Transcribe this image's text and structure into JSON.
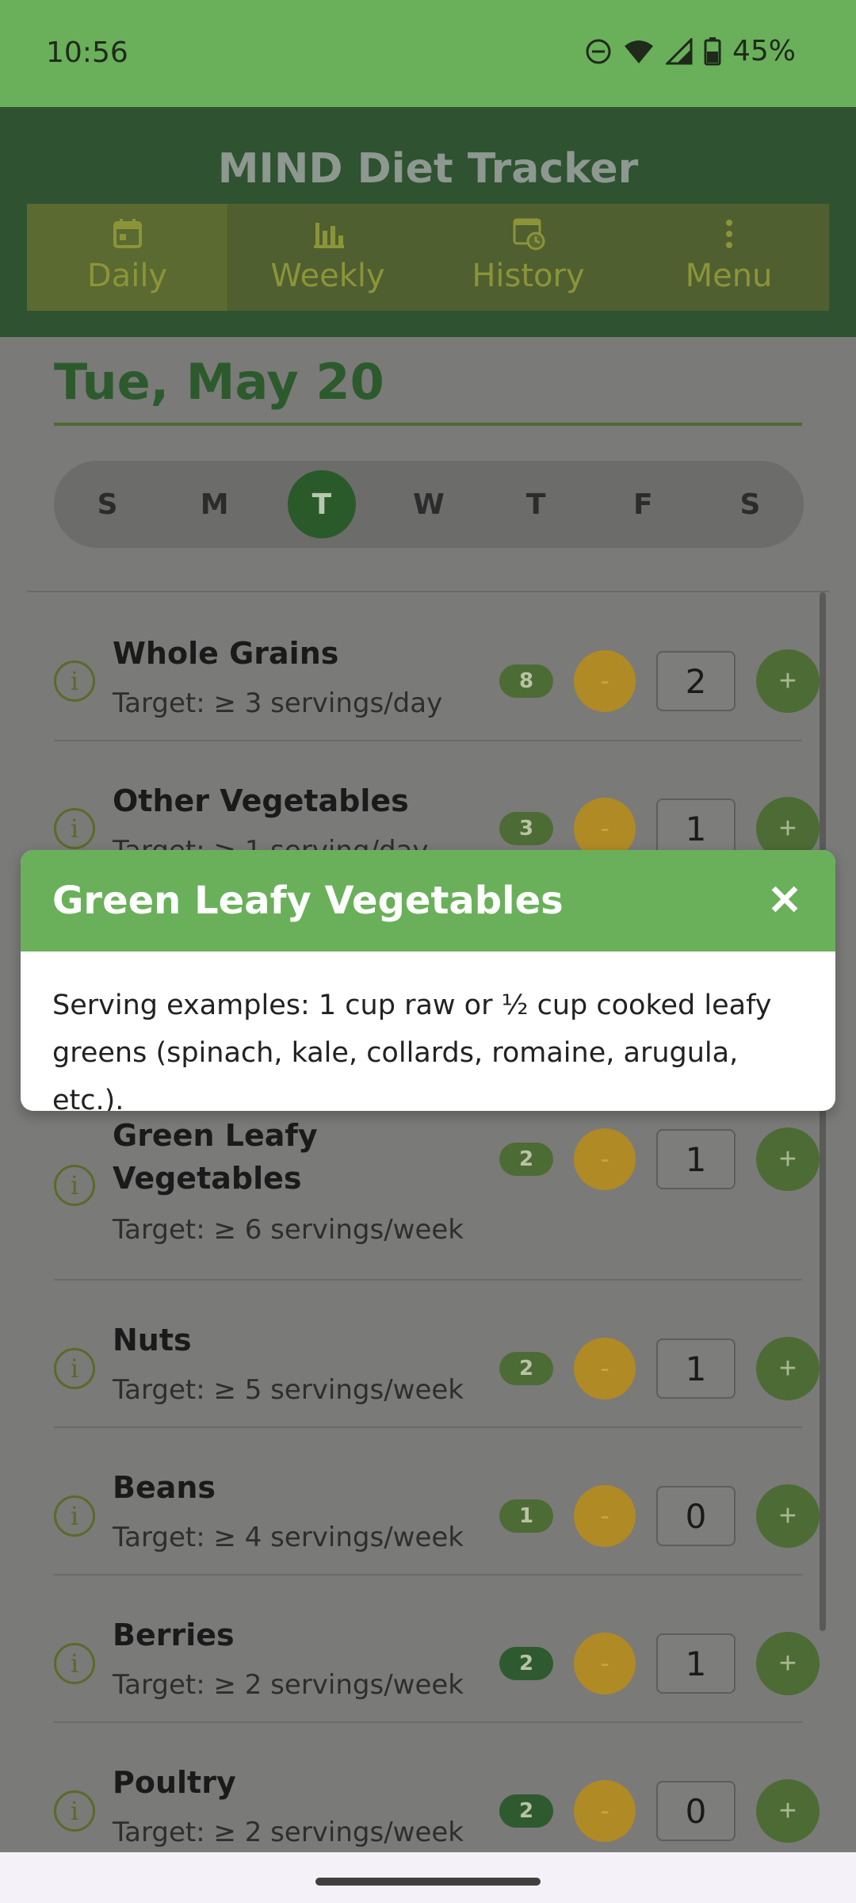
{
  "status_bar": {
    "time": "10:56",
    "battery": "45%"
  },
  "app": {
    "title": "MIND Diet Tracker"
  },
  "tabs": [
    {
      "label": "Daily",
      "icon": "calendar-icon",
      "active": true
    },
    {
      "label": "Weekly",
      "icon": "bar-chart-icon",
      "active": false
    },
    {
      "label": "History",
      "icon": "history-icon",
      "active": false
    },
    {
      "label": "Menu",
      "icon": "more-vertical-icon",
      "active": false
    }
  ],
  "date": {
    "title": "Tue, May 20"
  },
  "week": {
    "days": [
      "S",
      "M",
      "T",
      "W",
      "T",
      "F",
      "S"
    ],
    "active_index": 2
  },
  "foods": [
    {
      "name": "Whole Grains",
      "target": "Target: ≥ 3 servings/day",
      "badge": "8",
      "count": "2"
    },
    {
      "name": "Other Vegetables",
      "target": "Target: ≥ 1 serving/day",
      "badge": "3",
      "count": "1"
    },
    {
      "name": "Green Leafy Vegetables",
      "target": "Target: ≥ 6 servings/week",
      "badge": "2",
      "count": "1"
    },
    {
      "name": "Nuts",
      "target": "Target: ≥ 5 servings/week",
      "badge": "2",
      "count": "1"
    },
    {
      "name": "Beans",
      "target": "Target: ≥ 4 servings/week",
      "badge": "1",
      "count": "0"
    },
    {
      "name": "Berries",
      "target": "Target: ≥ 2 servings/week",
      "badge": "2",
      "count": "1"
    },
    {
      "name": "Poultry",
      "target": "Target: ≥ 2 servings/week",
      "badge": "2",
      "count": "0"
    }
  ],
  "modal": {
    "title": "Green Leafy Vegetables",
    "body": "Serving examples: 1 cup raw or ½ cup cooked leafy greens (spinach, kale, collards, romaine, arugula, etc.)."
  },
  "buttons": {
    "minus": "-",
    "plus": "+",
    "info": "i"
  },
  "colors": {
    "primary_green": "#6ab05a",
    "dark_green": "#2f5230",
    "minus_amber": "#b08a25"
  }
}
